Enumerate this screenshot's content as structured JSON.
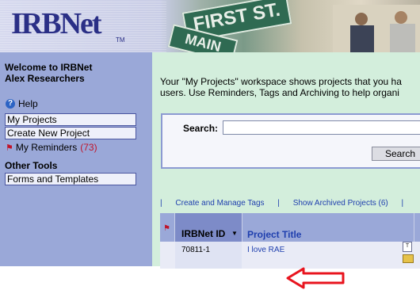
{
  "banner": {
    "logo": "IRBNet",
    "trademark": "TM",
    "sign_top": "FIRST ST.",
    "sign_bottom": "MAIN"
  },
  "sidebar": {
    "welcome_line1": "Welcome to IRBNet",
    "welcome_line2": "Alex Researchers",
    "help_label": "Help",
    "nav_items": [
      {
        "label": "My Projects"
      },
      {
        "label": "Create New Project"
      }
    ],
    "reminders_label": "My Reminders",
    "reminders_count": "(73)",
    "other_tools_heading": "Other Tools",
    "forms_templates_label": "Forms and Templates"
  },
  "main": {
    "intro_line1": "Your \"My Projects\" workspace shows projects that you ha",
    "intro_line2": "users. Use Reminders, Tags and Archiving to help organi",
    "search": {
      "label": "Search:",
      "value": "",
      "button": "Search"
    },
    "links": {
      "create_manage_tags": "Create and Manage Tags",
      "show_archived": "Show Archived Projects (6)",
      "sep": "|"
    },
    "table": {
      "columns": {
        "id": "IRBNet ID",
        "title": "Project Title"
      },
      "rows": [
        {
          "id": "70811-1",
          "title": "I love RAE"
        }
      ]
    }
  },
  "colors": {
    "sidebar_bg": "#9aa8d8",
    "main_bg": "#d3eedc",
    "link_blue": "#1f3fae",
    "reminder_red": "#c0142a",
    "annotation_arrow": "#e8141e"
  },
  "icons": {
    "help": "question-circle-icon",
    "reminder_flag": "flag-icon",
    "sort": "sort-down-icon",
    "tag": "t-tag-icon",
    "folder": "folder-icon",
    "annotation": "arrow-left-annotation"
  }
}
